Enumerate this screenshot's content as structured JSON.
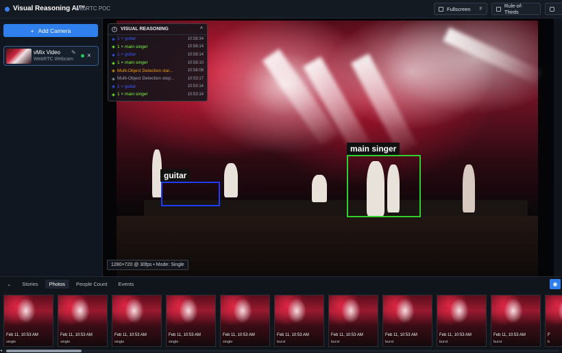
{
  "header": {
    "title": "Visual Reasoning AI™",
    "subtitle": "WebRTC POC",
    "fullscreen_label": "Fullscreen",
    "fullscreen_key": "F",
    "rule_of_thirds_label": "Rule-of-Thirds",
    "accent": "#3b82f6"
  },
  "sidebar": {
    "add_camera_label": "Add Camera",
    "camera": {
      "title": "vMix Video",
      "subtitle": "WebRTC Webcam",
      "status_color": "#22c55e"
    }
  },
  "video": {
    "resolution_info": "1280×720 @ 30fps • Mode: Single",
    "detections": [
      {
        "label": "guitar",
        "color": "#1e3cff"
      },
      {
        "label": "main singer",
        "color": "#2fd12f"
      }
    ]
  },
  "visual_reasoning": {
    "title": "VISUAL REASONING",
    "entries": [
      {
        "text": "1 × guitar",
        "time": "10:58:34",
        "color": "#3b5bff"
      },
      {
        "text": "1 × main singer",
        "time": "10:58:14",
        "color": "#7cff3b"
      },
      {
        "text": "1 × guitar",
        "time": "10:58:14",
        "color": "#3b5bff"
      },
      {
        "text": "1 × main singer",
        "time": "10:58:10",
        "color": "#7cff3b"
      },
      {
        "text": "Multi-Object Detection star...",
        "time": "10:58:08",
        "color": "#f59e0b"
      },
      {
        "text": "Multi-Object Detection stop...",
        "time": "10:53:17",
        "color": "#9aa4b2"
      },
      {
        "text": "1 × guitar",
        "time": "10:53:14",
        "color": "#3b5bff"
      },
      {
        "text": "1 × main singer",
        "time": "10:53:14",
        "color": "#7cff3b"
      }
    ]
  },
  "bottom": {
    "tabs": [
      "Stories",
      "Photos",
      "People Count",
      "Events"
    ],
    "active_tab": "Photos",
    "photos": [
      {
        "caption": "Feb 11, 10:53 AM",
        "kind": "single"
      },
      {
        "caption": "Feb 11, 10:53 AM",
        "kind": "single"
      },
      {
        "caption": "Feb 11, 10:53 AM",
        "kind": "single"
      },
      {
        "caption": "Feb 11, 10:53 AM",
        "kind": "single"
      },
      {
        "caption": "Feb 11, 10:53 AM",
        "kind": "single"
      },
      {
        "caption": "Feb 11, 10:53 AM",
        "kind": "burst"
      },
      {
        "caption": "Feb 11, 10:53 AM",
        "kind": "burst"
      },
      {
        "caption": "Feb 11, 10:53 AM",
        "kind": "burst"
      },
      {
        "caption": "Feb 11, 10:53 AM",
        "kind": "burst"
      },
      {
        "caption": "Feb 11, 10:53 AM",
        "kind": "burst"
      },
      {
        "caption": "F",
        "kind": "b"
      }
    ]
  }
}
